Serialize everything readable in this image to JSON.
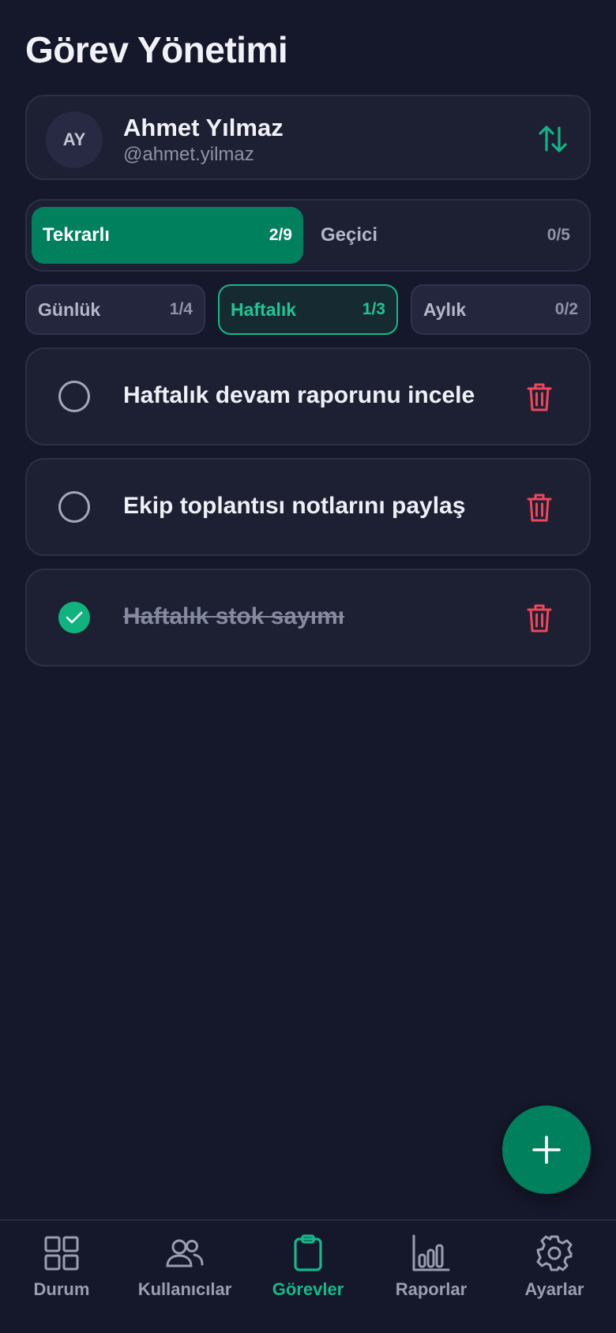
{
  "header": {
    "title": "Görev Yönetimi"
  },
  "user": {
    "initials": "AY",
    "name": "Ahmet Yılmaz",
    "handle": "@ahmet.yilmaz",
    "swap_icon": "swap-vertical-icon"
  },
  "segments": [
    {
      "label": "Tekrarlı",
      "count": "2/9",
      "active": true
    },
    {
      "label": "Geçici",
      "count": "0/5",
      "active": false
    }
  ],
  "subtabs": [
    {
      "label": "Günlük",
      "count": "1/4",
      "active": false
    },
    {
      "label": "Haftalık",
      "count": "1/3",
      "active": true
    },
    {
      "label": "Aylık",
      "count": "0/2",
      "active": false
    }
  ],
  "tasks": [
    {
      "text": "Haftalık devam raporunu incele",
      "done": false
    },
    {
      "text": "Ekip toplantısı notlarını paylaş",
      "done": false
    },
    {
      "text": "Haftalık stok sayımı",
      "done": true
    }
  ],
  "fab": {
    "icon": "plus-icon"
  },
  "nav": [
    {
      "label": "Durum",
      "icon": "grid-icon",
      "active": false
    },
    {
      "label": "Kullanıcılar",
      "icon": "users-icon",
      "active": false
    },
    {
      "label": "Görevler",
      "icon": "clipboard-icon",
      "active": true
    },
    {
      "label": "Raporlar",
      "icon": "bar-chart-icon",
      "active": false
    },
    {
      "label": "Ayarlar",
      "icon": "gear-icon",
      "active": false
    }
  ],
  "colors": {
    "background": "#15172a",
    "card": "#1d1f33",
    "accent": "#00805d",
    "accent_bright": "#15b98a",
    "danger": "#f0465a"
  }
}
